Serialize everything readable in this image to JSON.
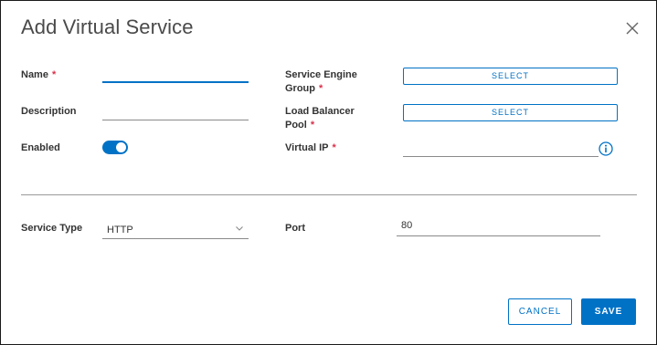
{
  "dialog": {
    "title": "Add Virtual Service"
  },
  "form": {
    "name": {
      "label": "Name",
      "required": "*",
      "value": ""
    },
    "description": {
      "label": "Description",
      "value": ""
    },
    "enabled": {
      "label": "Enabled",
      "state": "on"
    },
    "service_engine_group": {
      "label_line1": "Service Engine",
      "label_line2": "Group",
      "required": "*",
      "button_label": "SELECT"
    },
    "load_balancer_pool": {
      "label_line1": "Load Balancer",
      "label_line2": "Pool",
      "required": "*",
      "button_label": "SELECT"
    },
    "virtual_ip": {
      "label": "Virtual IP",
      "required": "*",
      "value": ""
    },
    "service_type": {
      "label": "Service Type",
      "selected": "HTTP"
    },
    "port": {
      "label": "Port",
      "value": "80"
    }
  },
  "footer": {
    "cancel_label": "CANCEL",
    "save_label": "SAVE"
  },
  "colors": {
    "accent": "#0072c6",
    "required": "#d9304a"
  },
  "icons": {
    "close": "close-icon",
    "info": "info-icon",
    "chevron": "chevron-down-icon"
  }
}
